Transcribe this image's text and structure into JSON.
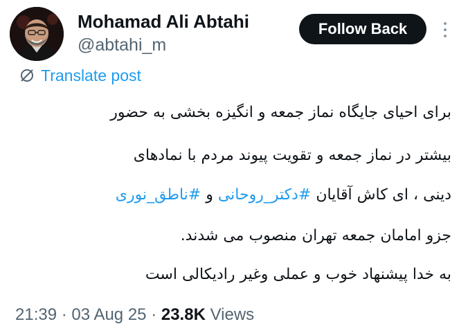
{
  "author": {
    "display_name": "Mohamad Ali Abtahi",
    "handle": "@abtahi_m"
  },
  "actions": {
    "follow_label": "Follow Back",
    "translate_label": "Translate post"
  },
  "icons": {
    "translate": "globe-slash-icon",
    "more": "more-vertical-icon",
    "avatar": "avatar"
  },
  "colors": {
    "accent": "#1d9bf0",
    "text": "#0f1419",
    "muted": "#536471",
    "button_bg": "#0f1419",
    "button_text": "#ffffff"
  },
  "post": {
    "line1": "برای احیای جایگاه نماز جمعه و انگیزه بخشی به حضور",
    "line2": "بیشتر در نماز جمعه و تقویت پیوند مردم با نمادهای",
    "line3_start": "دینی ، ای کاش آقایان",
    "hashtag1": "#دکتر_روحانی",
    "line3_mid": "و",
    "hashtag2": "#ناطق_نوری",
    "line4": "جزو امامان جمعه تهران منصوب می شدند.",
    "line5": "به خدا پیشنهاد خوب و عملی وغیر رادیکالی است"
  },
  "meta": {
    "time": "21:39",
    "sep1": "·",
    "date": "03 Aug 25",
    "sep2": "·",
    "views_count": "23.8K",
    "views_label": "Views"
  }
}
